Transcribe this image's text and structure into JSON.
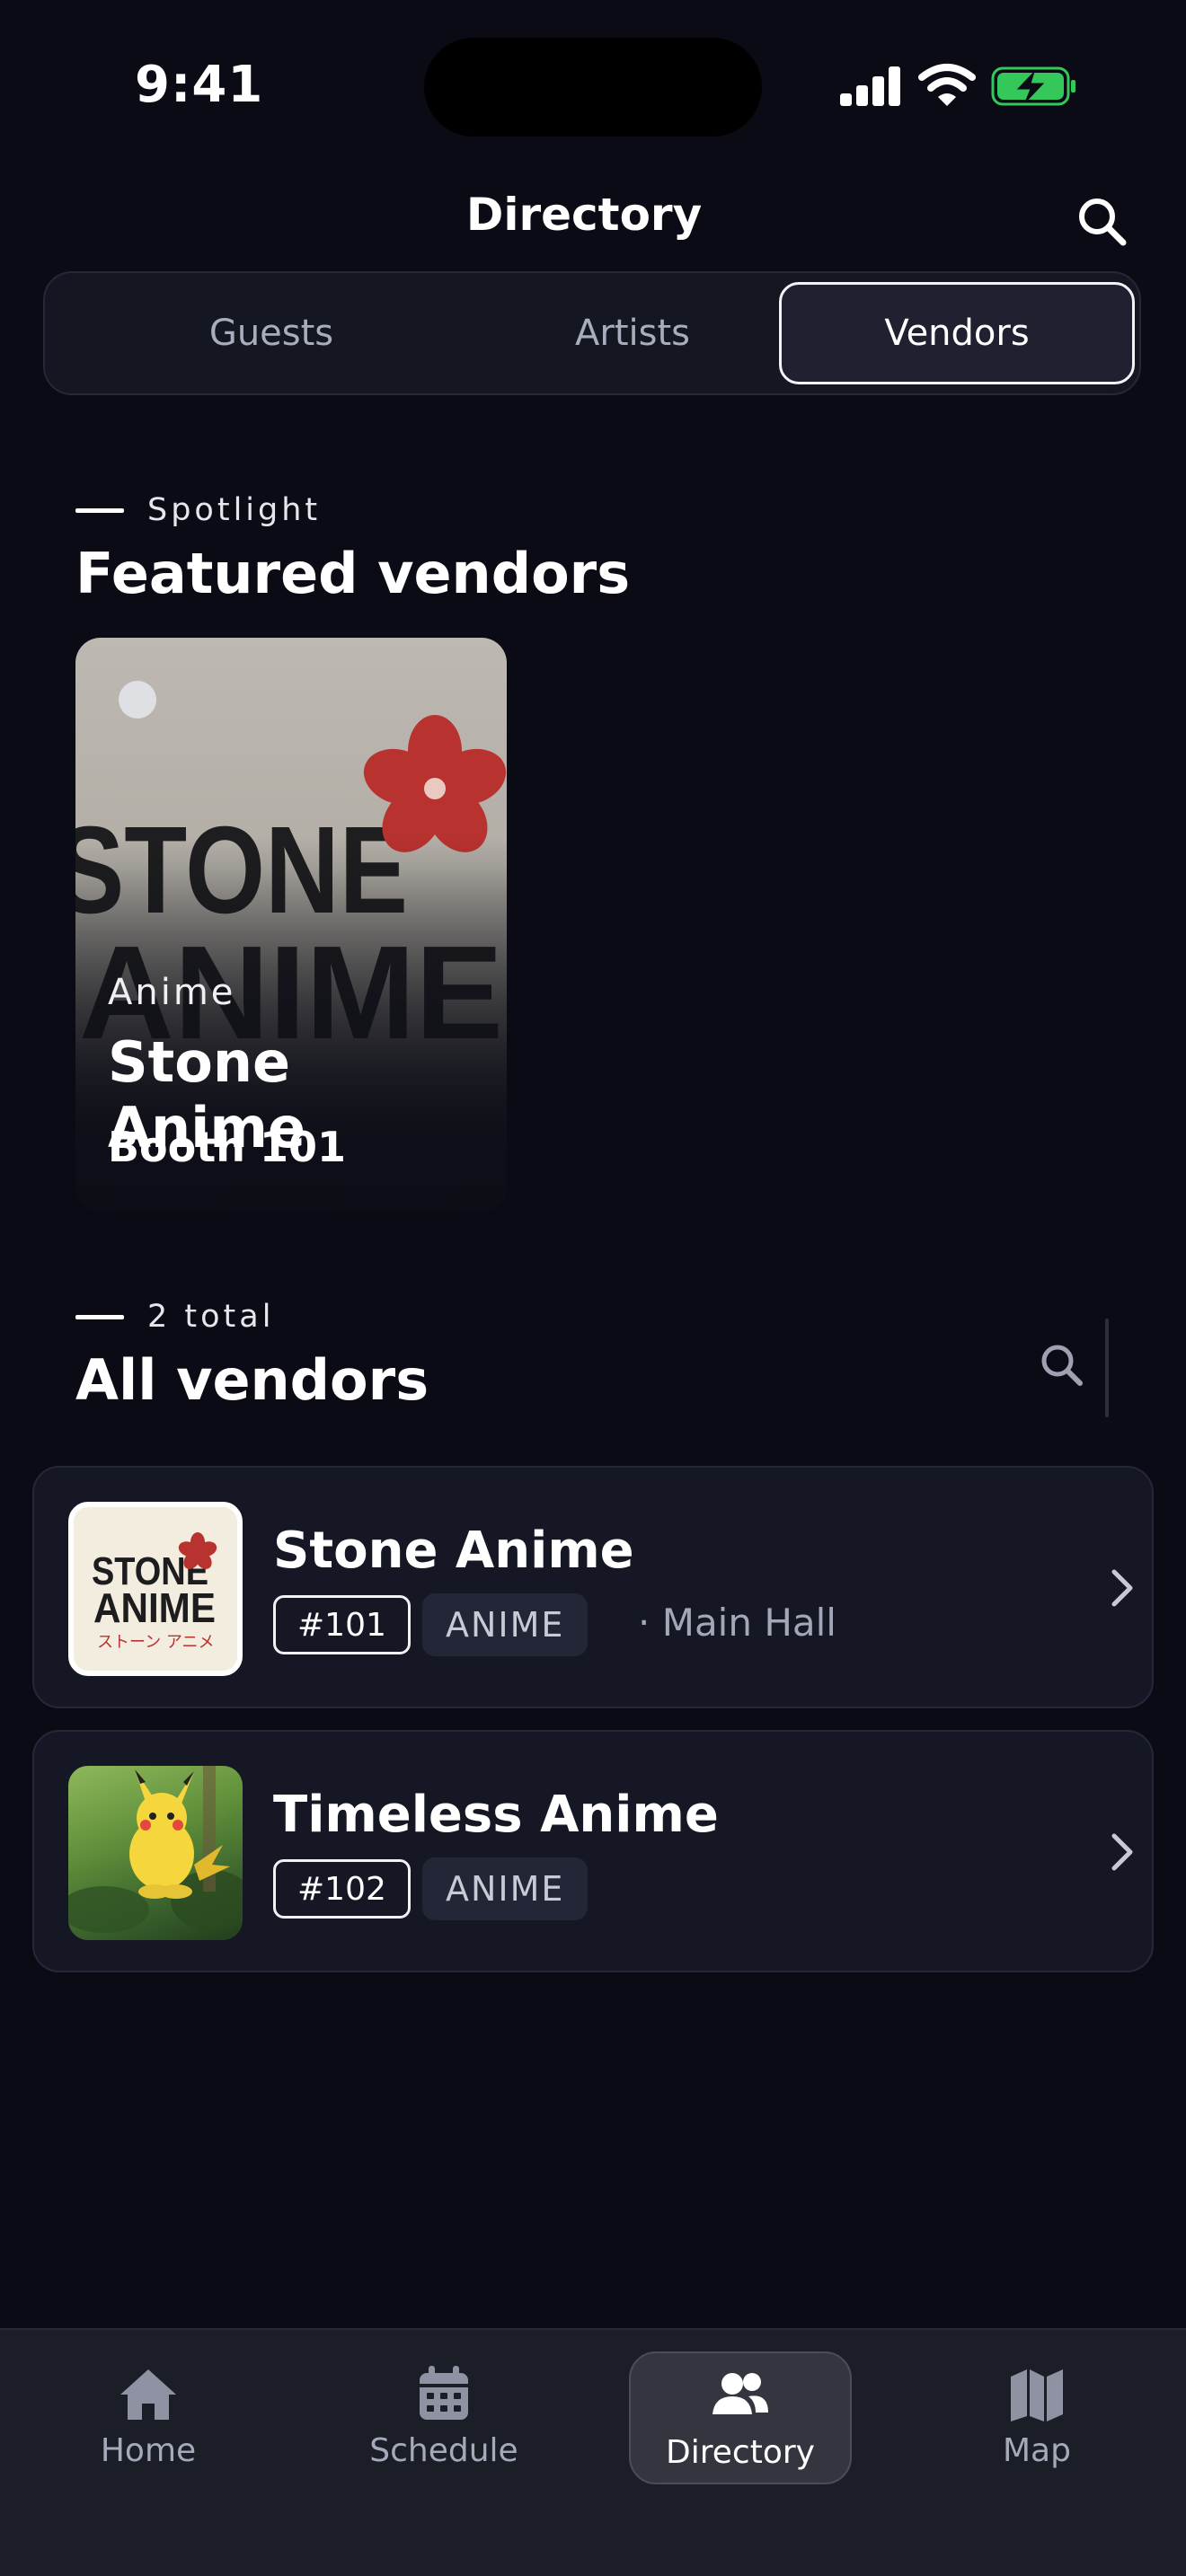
{
  "status_bar": {
    "time": "9:41"
  },
  "header": {
    "title": "Directory",
    "search_icon": "search-icon"
  },
  "segments": [
    {
      "label": "Guests",
      "active": false
    },
    {
      "label": "Artists",
      "active": false
    },
    {
      "label": "Vendors",
      "active": true
    }
  ],
  "spotlight": {
    "eyebrow": "Spotlight",
    "title": "Featured vendors",
    "card": {
      "category": "Anime",
      "name": "Stone Anime",
      "booth": "Booth 101",
      "logo_line1": "STONE",
      "logo_line2": "ANIME",
      "accent": "#b8322f"
    }
  },
  "all_vendors": {
    "eyebrow": "2 total",
    "title": "All vendors",
    "items": [
      {
        "name": "Stone Anime",
        "booth": "#101",
        "category": "ANIME",
        "location": "· Main Hall",
        "logo_line1": "STONE",
        "logo_line2": "ANIME",
        "logo_sub": "ストーン アニメ"
      },
      {
        "name": "Timeless Anime",
        "booth": "#102",
        "category": "ANIME",
        "location": ""
      }
    ]
  },
  "tab_bar": [
    {
      "label": "Home",
      "icon": "home-icon",
      "active": false
    },
    {
      "label": "Schedule",
      "icon": "calendar-icon",
      "active": false
    },
    {
      "label": "Directory",
      "icon": "people-icon",
      "active": true
    },
    {
      "label": "Map",
      "icon": "map-icon",
      "active": false
    }
  ],
  "colors": {
    "background": "#0a0b14",
    "surface": "#151724",
    "battery_green": "#34c759"
  }
}
